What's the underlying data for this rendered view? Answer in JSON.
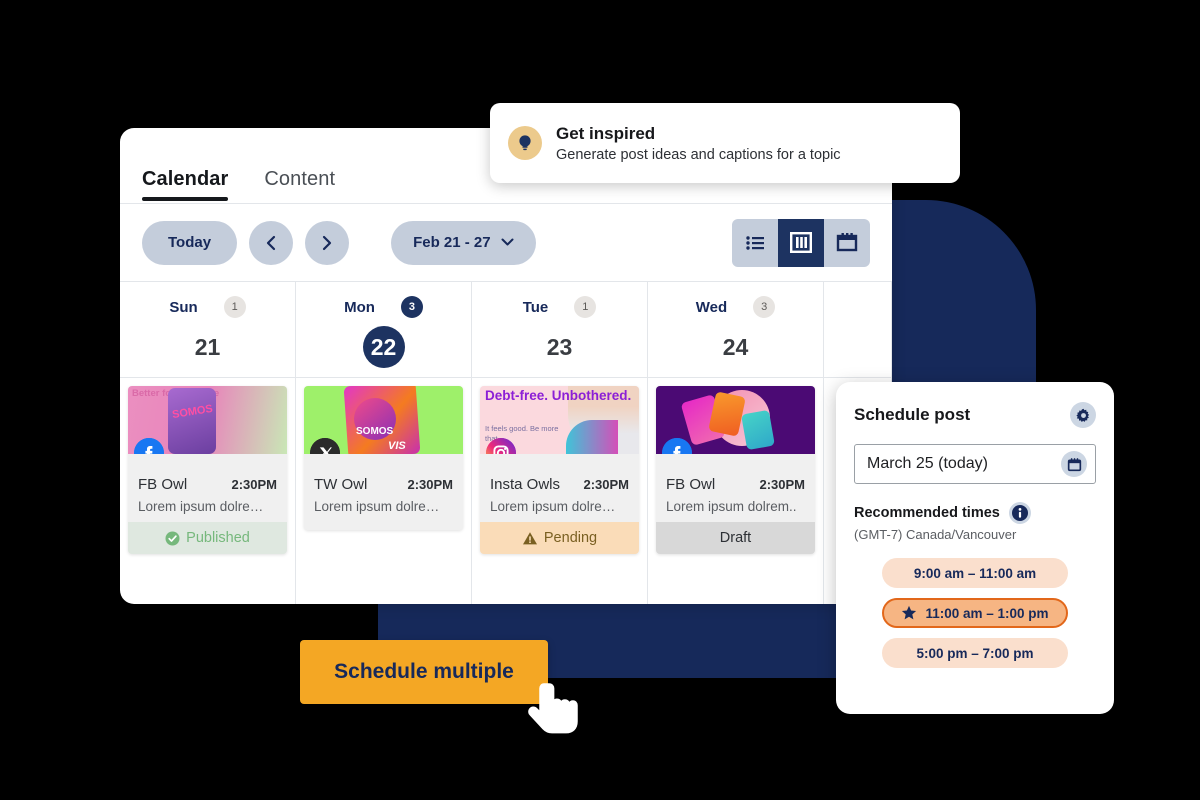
{
  "tabs": [
    {
      "label": "Calendar",
      "active": true
    },
    {
      "label": "Content",
      "active": false
    }
  ],
  "toolbar": {
    "today_label": "Today",
    "prev_icon": "chevron-left-icon",
    "next_icon": "chevron-right-icon",
    "date_range": "Feb 21 - 27",
    "range_chevron_icon": "chevron-down-icon",
    "views": [
      {
        "name": "list-view",
        "icon": "list-icon",
        "active": false
      },
      {
        "name": "board-view",
        "icon": "columns-icon",
        "active": true
      },
      {
        "name": "month-view",
        "icon": "calendar-icon",
        "active": false
      }
    ]
  },
  "days": [
    {
      "name": "Sun",
      "number": "21",
      "count": "1",
      "today": false,
      "count_highlight": false
    },
    {
      "name": "Mon",
      "number": "22",
      "count": "3",
      "today": true,
      "count_highlight": true
    },
    {
      "name": "Tue",
      "number": "23",
      "count": "1",
      "today": false,
      "count_highlight": false
    },
    {
      "name": "Wed",
      "number": "24",
      "count": "3",
      "today": false,
      "count_highlight": false
    }
  ],
  "posts": [
    {
      "network": "facebook",
      "title": "FB Owl",
      "time": "2:30PM",
      "excerpt": "Lorem ipsum dolre…",
      "status": "Published",
      "status_kind": "published",
      "status_icon": "check-circle-icon",
      "art_brand": "SOMOS",
      "art_headline": "Better for everyone"
    },
    {
      "network": "x",
      "title": "TW Owl",
      "time": "2:30PM",
      "excerpt": "Lorem ipsum dolre…",
      "status": "",
      "status_kind": "none",
      "status_icon": "",
      "art_brand": "SOMOS",
      "art_headline": "VIS"
    },
    {
      "network": "instagram",
      "title": "Insta Owls",
      "time": "2:30PM",
      "excerpt": "Lorem ipsum dolre…",
      "status": "Pending",
      "status_kind": "pending",
      "status_icon": "warning-triangle-icon",
      "art_headline": "Debt-free. Unbothered.",
      "art_sub": "It feels good. Be more that."
    },
    {
      "network": "facebook",
      "title": "FB Owl",
      "time": "2:30PM",
      "excerpt": "Lorem ipsum dolrem..",
      "status": "Draft",
      "status_kind": "draft",
      "status_icon": "",
      "art_brand": "",
      "art_headline": ""
    }
  ],
  "inspire": {
    "icon": "lightbulb-icon",
    "title": "Get inspired",
    "subtitle": "Generate post ideas and captions for a topic"
  },
  "schedule": {
    "title": "Schedule post",
    "settings_icon": "gear-icon",
    "date_value": "March 25 (today)",
    "date_icon": "calendar-icon",
    "recommended_label": "Recommended times",
    "info_icon": "info-icon",
    "timezone": "(GMT-7) Canada/Vancouver",
    "times": [
      {
        "label": "9:00 am – 11:00 am",
        "selected": false,
        "icon": ""
      },
      {
        "label": "11:00 am – 1:00 pm",
        "selected": true,
        "icon": "star-icon"
      },
      {
        "label": "5:00 pm – 7:00 pm",
        "selected": false,
        "icon": ""
      }
    ]
  },
  "cta": {
    "label": "Schedule multiple",
    "cursor_icon": "pointer-hand-icon"
  },
  "colors": {
    "navy": "#17295a",
    "navy_dark": "#1d3361",
    "pill_grey": "#c4cddb",
    "amber": "#f4a724",
    "peach": "#fadfcd",
    "peach_selected": "#f6b583",
    "orange_border": "#e2671a",
    "green": "#76b87c",
    "pending_bg": "#fadcb8",
    "draft_bg": "#d8d8d8"
  }
}
